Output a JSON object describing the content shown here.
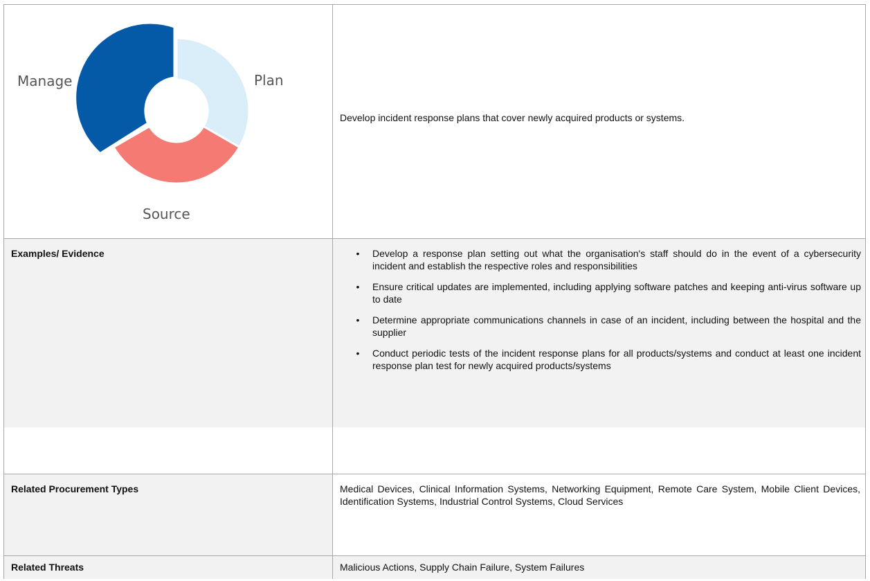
{
  "wheel": {
    "segments": [
      {
        "label": "Plan",
        "color": "#daeefa",
        "active": false
      },
      {
        "label": "Source",
        "color": "#f47a73",
        "active": false
      },
      {
        "label": "Manage",
        "color": "#055aa8",
        "active": true
      }
    ]
  },
  "description": "Develop incident response plans that cover newly acquired products or systems.",
  "rows": {
    "examples": {
      "label": "Examples/ Evidence",
      "items": [
        "Develop a response plan setting out what the organisation's staff should do in the event of a cybersecurity incident and establish the respective roles and responsibilities",
        "Ensure critical updates are implemented, including applying software patches and keeping anti-virus software up to date",
        "Determine appropriate communications channels in case of an incident, including between the hospital and the supplier",
        "Conduct periodic tests of the incident response plans for all products/systems and conduct at least one incident response plan test for newly acquired products/systems"
      ]
    },
    "procurement": {
      "label": "Related Procurement Types",
      "value": "Medical Devices, Clinical Information Systems, Networking Equipment, Remote Care System, Mobile Client Devices, Identification Systems, Industrial Control Systems, Cloud Services"
    },
    "threats": {
      "label": "Related Threats",
      "value": "Malicious Actions, Supply Chain Failure, System Failures"
    }
  }
}
